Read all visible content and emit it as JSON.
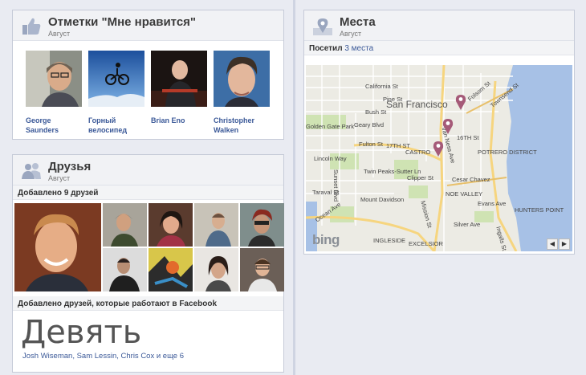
{
  "likes": {
    "title": "Отметки \"Мне нравится\"",
    "subtitle": "Август",
    "items": [
      {
        "name": "George Saunders"
      },
      {
        "name": "Горный велосипед"
      },
      {
        "name": "Brian Eno"
      },
      {
        "name": "Christopher Walken"
      }
    ]
  },
  "friends": {
    "title": "Друзья",
    "subtitle": "Август",
    "added_label": "Добавлено 9 друзей",
    "work_label": "Добавлено друзей, которые работают в Facebook",
    "big_count": "Девять",
    "names_list": {
      "n1": "Josh Wiseman",
      "n2": "Sam Lessin",
      "n3": "Chris Cox",
      "more": "и еще 6"
    }
  },
  "places": {
    "title": "Места",
    "subtitle": "Август",
    "visited_prefix": "Посетил",
    "visited_link": "3 места",
    "map": {
      "provider_logo": "bing",
      "labels": [
        {
          "t": "California St"
        },
        {
          "t": "Pine St"
        },
        {
          "t": "Bush St"
        },
        {
          "t": "Geary Blvd"
        },
        {
          "t": "San Francisco"
        },
        {
          "t": "Fulton St"
        },
        {
          "t": "Golden Gate Park"
        },
        {
          "t": "17TH ST"
        },
        {
          "t": "CASTRO"
        },
        {
          "t": "Twin Peaks-Sutter Ln"
        },
        {
          "t": "Clipper St"
        },
        {
          "t": "Cesar Chavez"
        },
        {
          "t": "Taraval St"
        },
        {
          "t": "Mount Davidson"
        },
        {
          "t": "Ocean Ave"
        },
        {
          "t": "INGLESIDE"
        },
        {
          "t": "EXCELSIOR"
        },
        {
          "t": "Silver Ave"
        },
        {
          "t": "POTRERO DISTRICT"
        },
        {
          "t": "HUNTERS POINT"
        },
        {
          "t": "Townsend St"
        },
        {
          "t": "Folsom St"
        },
        {
          "t": "16TH St"
        },
        {
          "t": "Van Ness Ave"
        },
        {
          "t": "Geneva Ave"
        },
        {
          "t": "Mission St"
        },
        {
          "t": "Ingalls St"
        },
        {
          "t": "Evans Ave"
        },
        {
          "t": "Lincoln Way"
        },
        {
          "t": "Sunset Blvd"
        },
        {
          "t": "NOE VALLEY"
        }
      ]
    }
  },
  "colors": {
    "link": "#3b5998",
    "pin": "#a55a78",
    "water": "#a7c1e6",
    "park": "#cfe3b3"
  }
}
